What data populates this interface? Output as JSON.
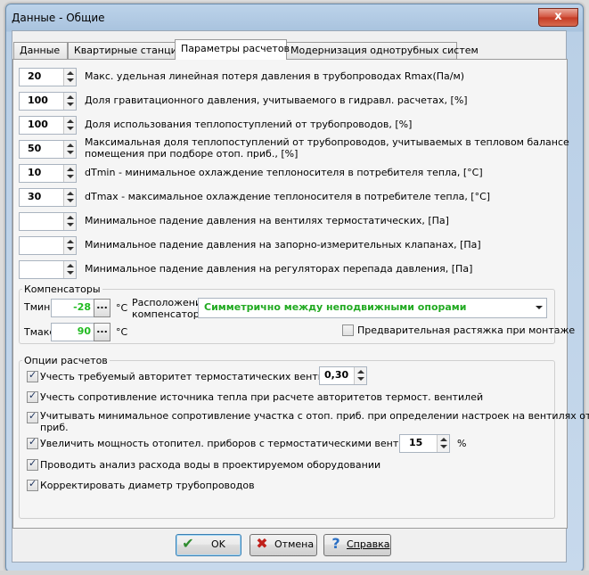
{
  "window": {
    "title": "Данные - Общие",
    "close_glyph": "x"
  },
  "tabs": [
    {
      "label": "Данные"
    },
    {
      "label": "Квартирные станции"
    },
    {
      "label": "Параметры расчетов",
      "active": true
    },
    {
      "label": "Модернизация однотрубных систем"
    }
  ],
  "params": [
    {
      "value": "20",
      "label": "Макс. удельная линейная потеря давления в трубопроводах Rmax(Па/м)"
    },
    {
      "value": "100",
      "label": "Доля гравитационного давления, учитываемого в гидравл. расчетах, [%]"
    },
    {
      "value": "100",
      "label": "Доля использования теплопоступлений от трубопроводов, [%]"
    },
    {
      "value": "50",
      "label": "Максимальная доля теплопоступлений от трубопроводов, учитываемых в тепловом балансе",
      "label2": "помещения при подборе отоп. приб., [%]"
    },
    {
      "value": "10",
      "label": "dTmin - минимальное охлаждение теплоносителя в потребителя тепла, [°C]"
    },
    {
      "value": "30",
      "label": "dTmax - максимальное охлаждение теплоносителя в потребителе тепла, [°C]"
    },
    {
      "value": "",
      "label": "Минимальное падение давления на вентилях термостатических, [Па]"
    },
    {
      "value": "",
      "label": "Минимальное падение давления на запорно-измерительных клапанах, [Па]"
    },
    {
      "value": "",
      "label": "Минимальное падение давления на регуляторах перепада давления, [Па]"
    }
  ],
  "compensators": {
    "title": "Компенсаторы",
    "tmin_label": "Tмин",
    "tmin_value": "-28",
    "tmax_label": "Tмакс",
    "tmax_value": "90",
    "unit": "°C",
    "dots": "...",
    "location_label_1": "Расположение",
    "location_label_2": "компенсатора",
    "location_value": "Симметрично между неподвижными опорами",
    "prestretch_label": "Предварительная растяжка при монтаже",
    "prestretch_checked": false
  },
  "options": {
    "title": "Опции расчетов",
    "items": [
      {
        "label": "Учесть требуемый авторитет термостатических вентилей",
        "checked": true
      },
      {
        "label": "Учесть сопротивление источника тепла при расчете авторитетов термост. вентилей",
        "checked": true
      },
      {
        "label": "Учитывать минимальное сопротивление участка с отоп. приб. при определении настроек на вентилях отоп.",
        "label2": "приб.",
        "checked": true
      },
      {
        "label": "Увеличить мощность отопител. приборов с термостатическими вентилями на",
        "checked": true
      },
      {
        "label": "Проводить анализ расхода воды в проектируемом оборудовании",
        "checked": true
      },
      {
        "label": "Корректировать диаметр трубопроводов",
        "checked": true
      }
    ],
    "authority_value": "0,30",
    "increase_value": "15",
    "increase_unit": "%"
  },
  "buttons": {
    "ok": "OK",
    "cancel": "Отмена",
    "help": "Справка"
  },
  "colors": {
    "accent_green": "#22aa22",
    "ok_icon": "#2e8b2e",
    "cancel_icon": "#c0201a",
    "help_icon": "#2a6fc4"
  }
}
